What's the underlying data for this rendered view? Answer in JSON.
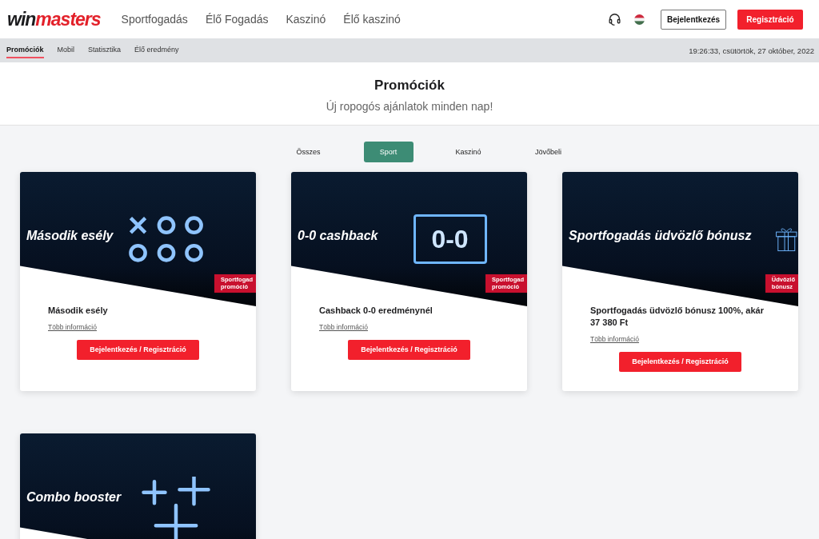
{
  "header": {
    "logo_dark": "win",
    "logo_red": "masters",
    "nav": [
      "Sportfogadás",
      "Élő Fogadás",
      "Kaszinó",
      "Élő kaszinó"
    ],
    "login": "Bejelentkezés",
    "register": "Regisztráció"
  },
  "subnav": {
    "items": [
      {
        "label": "Promóciók",
        "selected": true
      },
      {
        "label": "Mobil",
        "selected": false
      },
      {
        "label": "Statisztika",
        "selected": false
      },
      {
        "label": "Élő eredmény",
        "selected": false
      }
    ],
    "datetime": "19:26:33, csütörtök, 27 október, 2022"
  },
  "hero": {
    "title": "Promóciók",
    "subtitle": "Új ropogós ajánlatok minden nap!"
  },
  "filters": [
    {
      "label": "Összes",
      "selected": false
    },
    {
      "label": "Sport",
      "selected": true
    },
    {
      "label": "Kaszinó",
      "selected": false
    },
    {
      "label": "Jövőbeli",
      "selected": false
    }
  ],
  "cards": [
    {
      "kind": "tictactoe",
      "banner_title": "Második esély",
      "ribbon": [
        "Sportfogad",
        "promóció"
      ],
      "title": "Második esély",
      "link": "Több információ",
      "button": "Bejelentkezés / Regisztráció"
    },
    {
      "kind": "scoreboard",
      "banner_title": "0-0 cashback",
      "score": "0-0",
      "ribbon": [
        "Sportfogad",
        "promóció"
      ],
      "title": "Cashback 0-0 eredménynél",
      "link": "Több információ",
      "button": "Bejelentkezés / Regisztráció"
    },
    {
      "kind": "gift",
      "banner_title": "Sportfogadás üdvözlő bónusz",
      "ribbon": [
        "Üdvözlő",
        "bónusz"
      ],
      "title": "Sportfogadás üdvözlő bónusz 100%, akár 37 380 Ft",
      "link": "Több információ",
      "button": "Bejelentkezés / Regisztráció"
    },
    {
      "kind": "plus",
      "banner_title": "Combo booster"
    }
  ]
}
